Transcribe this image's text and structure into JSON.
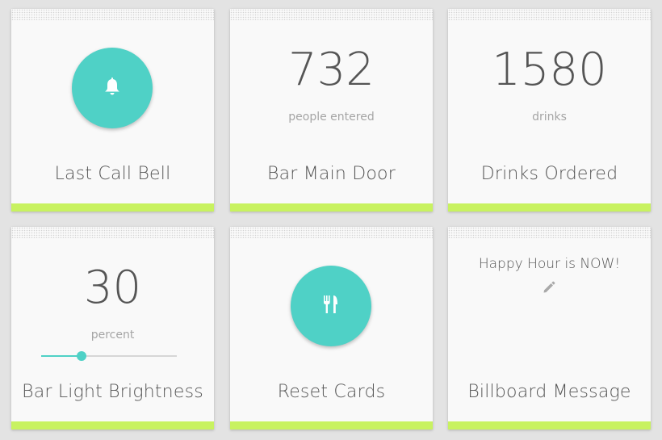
{
  "colors": {
    "accent_bar": "#c8f260",
    "teal": "#4fd1c6",
    "background": "#e3e3e3",
    "card": "#f9f9f9"
  },
  "cards": [
    {
      "title": "Last Call Bell",
      "icon": "bell-icon"
    },
    {
      "title": "Bar Main Door",
      "value": "732",
      "unit": "people entered"
    },
    {
      "title": "Drinks Ordered",
      "value": "1580",
      "unit": "drinks"
    },
    {
      "title": "Bar Light Brightness",
      "value": "30",
      "unit": "percent",
      "slider_value": 30
    },
    {
      "title": "Reset Cards",
      "icon": "utensils-icon"
    },
    {
      "title": "Billboard Message",
      "message": "Happy Hour is NOW!",
      "icon": "pencil-icon"
    }
  ]
}
